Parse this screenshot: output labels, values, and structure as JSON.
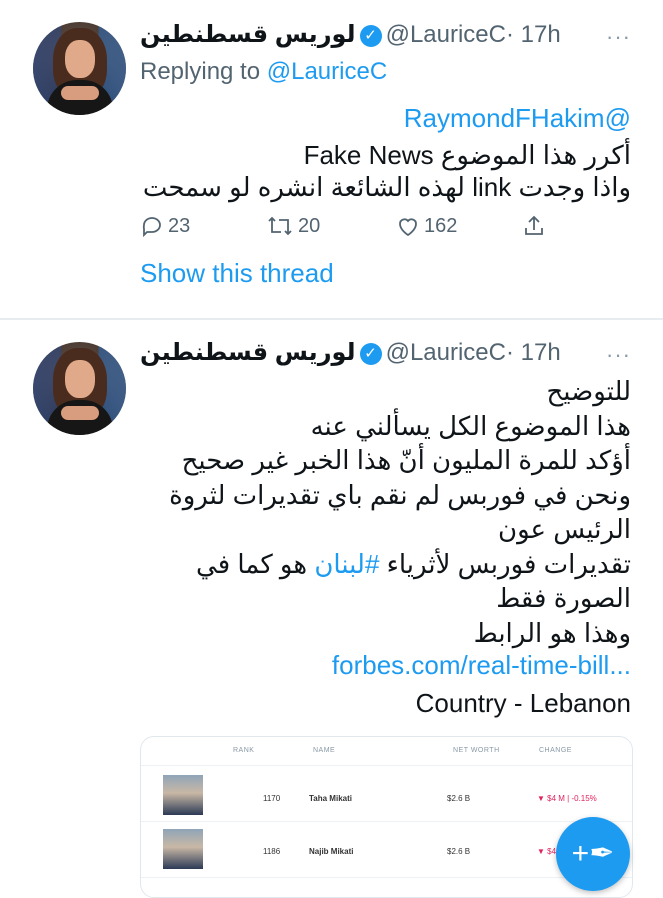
{
  "tweets": [
    {
      "author_name": "لوريس قسطنطين",
      "handle": "@LauriceC",
      "time": "· 17h",
      "more": "···",
      "replying_label": "Replying to",
      "replying_handle": "@LauriceC",
      "mention": "@RaymondFHakim",
      "lines": [
        "أكرر هذا الموضوع Fake News",
        "واذا وجدت link لهذه الشائعة انشره لو سمحت"
      ],
      "replies": "23",
      "retweets": "20",
      "likes": "162",
      "show_thread": "Show this thread"
    },
    {
      "author_name": "لوريس قسطنطين",
      "handle": "@LauriceC",
      "time": "· 17h",
      "more": "···",
      "lines": [
        "للتوضيح",
        "هذا الموضوع الكل يسألني عنه",
        "أؤكد للمرة المليون أنّ هذا الخبر غير صحيح",
        "ونحن في فوربس لم نقم باي تقديرات لثروة",
        "الرئيس عون",
        "تقديرات فوربس لأثرياء",
        "#لبنان",
        "هو كما في",
        "الصورة فقط",
        "وهذا هو الرابط"
      ],
      "link": "forbes.com/real-time-bill...",
      "country_line": "Country - Lebanon",
      "card": {
        "headers": [
          "RANK",
          "NAME",
          "NET WORTH",
          "CHANGE"
        ],
        "rows": [
          {
            "rank": "1170",
            "name": "Taha Mikati",
            "worth": "$2.6 B",
            "change": "▼ $4 M | -0.15%"
          },
          {
            "rank": "1186",
            "name": "Najib Mikati",
            "worth": "$2.6 B",
            "change": "▼ $4"
          }
        ]
      }
    }
  ],
  "fab": {
    "icon": "compose-icon",
    "glyph": "+✒"
  },
  "colors": {
    "accent": "#1d9bf0",
    "text": "#0f1419",
    "secondary": "#536471"
  }
}
